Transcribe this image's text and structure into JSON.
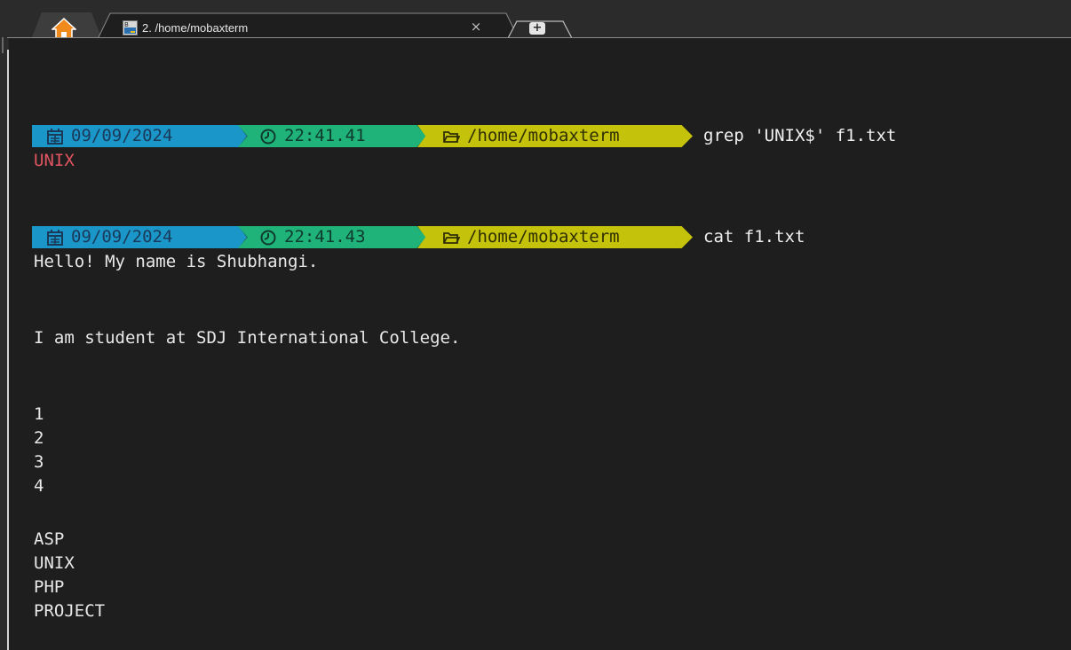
{
  "window": {
    "tab_title": "2. /home/mobaxterm",
    "close_glyph": "×",
    "new_tab_glyph": "+"
  },
  "colors": {
    "date_segment": "#1a96c8",
    "time_segment": "#1fb37a",
    "path_segment": "#c5c20c",
    "error_text": "#e05561",
    "background": "#1e1e1e"
  },
  "terminal": {
    "prompts": [
      {
        "date": "09/09/2024",
        "time": "22:41.41",
        "path": "/home/mobaxterm",
        "command": "grep 'UNIX$' f1.txt",
        "icons": [
          "calendar-icon",
          "clock-icon",
          "folder-icon"
        ]
      },
      {
        "date": "09/09/2024",
        "time": "22:41.43",
        "path": "/home/mobaxterm",
        "command": "cat f1.txt",
        "icons": [
          "calendar-icon",
          "clock-icon",
          "folder-icon"
        ]
      }
    ],
    "grep_output": "UNIX",
    "cat_output": [
      "Hello! My name is Shubhangi.",
      "I am student at SDJ International College.",
      "1",
      "2",
      "3",
      "4",
      "ASP",
      "UNIX",
      "PHP",
      "PROJECT"
    ]
  }
}
